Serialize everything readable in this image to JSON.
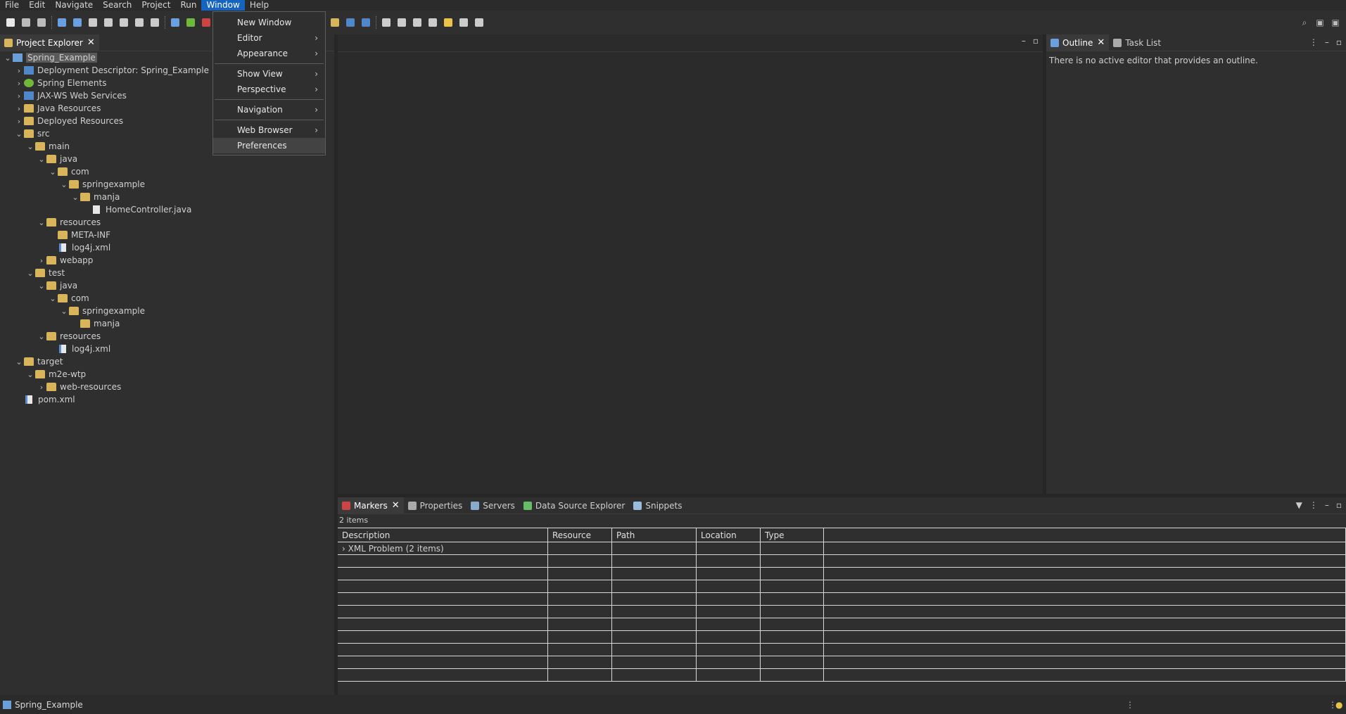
{
  "menubar": [
    "File",
    "Edit",
    "Navigate",
    "Search",
    "Project",
    "Run",
    "Window",
    "Help"
  ],
  "window_menu": {
    "items": [
      {
        "label": "New Window",
        "submenu": false
      },
      {
        "label": "Editor",
        "submenu": true
      },
      {
        "label": "Appearance",
        "submenu": true
      },
      {
        "sep": true
      },
      {
        "label": "Show View",
        "submenu": true
      },
      {
        "label": "Perspective",
        "submenu": true
      },
      {
        "sep": true
      },
      {
        "label": "Navigation",
        "submenu": true
      },
      {
        "sep": true
      },
      {
        "label": "Web Browser",
        "submenu": true
      },
      {
        "label": "Preferences",
        "submenu": false,
        "hover": true
      }
    ],
    "arrow": "›"
  },
  "project_explorer": {
    "tab_label": "Project Explorer",
    "tree": [
      {
        "label": "Spring_Example",
        "depth": 0,
        "chev": "v",
        "icon": "proj",
        "selected": true
      },
      {
        "label": "Deployment Descriptor: Spring_Example",
        "depth": 1,
        "chev": ">",
        "icon": "blue"
      },
      {
        "label": "Spring Elements",
        "depth": 1,
        "chev": ">",
        "icon": "green"
      },
      {
        "label": "JAX-WS Web Services",
        "depth": 1,
        "chev": ">",
        "icon": "blue"
      },
      {
        "label": "Java Resources",
        "depth": 1,
        "chev": ">",
        "icon": "folder"
      },
      {
        "label": "Deployed Resources",
        "depth": 1,
        "chev": ">",
        "icon": "folder"
      },
      {
        "label": "src",
        "depth": 1,
        "chev": "v",
        "icon": "folder"
      },
      {
        "label": "main",
        "depth": 2,
        "chev": "v",
        "icon": "folder"
      },
      {
        "label": "java",
        "depth": 3,
        "chev": "v",
        "icon": "folder"
      },
      {
        "label": "com",
        "depth": 4,
        "chev": "v",
        "icon": "folder"
      },
      {
        "label": "springexample",
        "depth": 5,
        "chev": "v",
        "icon": "folder"
      },
      {
        "label": "manja",
        "depth": 6,
        "chev": "v",
        "icon": "folder"
      },
      {
        "label": "HomeController.java",
        "depth": 7,
        "chev": "",
        "icon": "file"
      },
      {
        "label": "resources",
        "depth": 3,
        "chev": "v",
        "icon": "folder"
      },
      {
        "label": "META-INF",
        "depth": 4,
        "chev": "",
        "icon": "folder"
      },
      {
        "label": "log4j.xml",
        "depth": 4,
        "chev": "",
        "icon": "xml"
      },
      {
        "label": "webapp",
        "depth": 3,
        "chev": ">",
        "icon": "folder"
      },
      {
        "label": "test",
        "depth": 2,
        "chev": "v",
        "icon": "folder"
      },
      {
        "label": "java",
        "depth": 3,
        "chev": "v",
        "icon": "folder"
      },
      {
        "label": "com",
        "depth": 4,
        "chev": "v",
        "icon": "folder"
      },
      {
        "label": "springexample",
        "depth": 5,
        "chev": "v",
        "icon": "folder"
      },
      {
        "label": "manja",
        "depth": 6,
        "chev": "",
        "icon": "folder"
      },
      {
        "label": "resources",
        "depth": 3,
        "chev": "v",
        "icon": "folder"
      },
      {
        "label": "log4j.xml",
        "depth": 4,
        "chev": "",
        "icon": "xml"
      },
      {
        "label": "target",
        "depth": 1,
        "chev": "v",
        "icon": "folder"
      },
      {
        "label": "m2e-wtp",
        "depth": 2,
        "chev": "v",
        "icon": "folder"
      },
      {
        "label": "web-resources",
        "depth": 3,
        "chev": ">",
        "icon": "folder"
      },
      {
        "label": "pom.xml",
        "depth": 1,
        "chev": "",
        "icon": "xml"
      }
    ]
  },
  "outline": {
    "tabs": [
      {
        "label": "Outline",
        "active": true
      },
      {
        "label": "Task List",
        "active": false
      }
    ],
    "message": "There is no active editor that provides an outline."
  },
  "bottom": {
    "tabs": [
      {
        "label": "Markers",
        "active": true,
        "color": "#c44"
      },
      {
        "label": "Properties",
        "active": false,
        "color": "#aaa"
      },
      {
        "label": "Servers",
        "active": false,
        "color": "#8ac"
      },
      {
        "label": "Data Source Explorer",
        "active": false,
        "color": "#6b6"
      },
      {
        "label": "Snippets",
        "active": false,
        "color": "#9bd"
      }
    ],
    "count": "2 items",
    "columns": [
      "Description",
      "Resource",
      "Path",
      "Location",
      "Type"
    ],
    "rows": [
      [
        "XML Problem (2 items)",
        "",
        "",
        "",
        ""
      ]
    ]
  },
  "statusbar": {
    "text": "Spring_Example"
  },
  "icons": {
    "close": "✕",
    "minimize": "–",
    "maximize": "▫",
    "filter": "filter-icon",
    "tip": "lightbulb-icon"
  }
}
